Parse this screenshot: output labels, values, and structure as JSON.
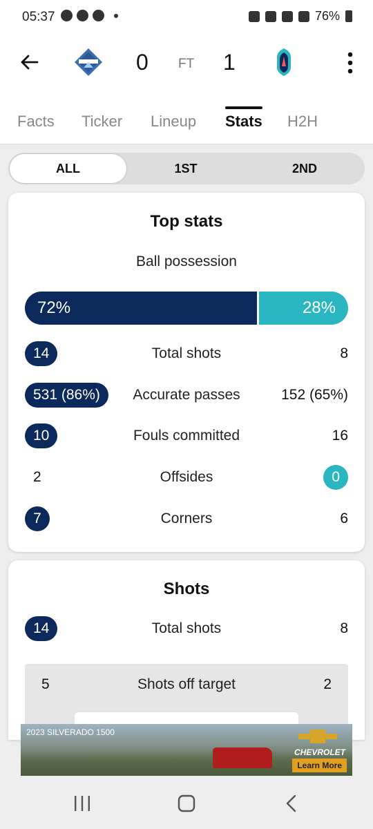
{
  "status_bar": {
    "time": "05:37",
    "battery": "76%"
  },
  "match": {
    "home_score": "0",
    "status": "FT",
    "away_score": "1"
  },
  "tabs": [
    {
      "label": "Facts"
    },
    {
      "label": "Ticker"
    },
    {
      "label": "Lineup"
    },
    {
      "label": "Stats"
    },
    {
      "label": "H2H"
    }
  ],
  "periods": [
    {
      "label": "ALL"
    },
    {
      "label": "1ST"
    },
    {
      "label": "2ND"
    }
  ],
  "top_stats": {
    "title": "Top stats",
    "possession": {
      "label": "Ball possession",
      "home": "72%",
      "away": "28%",
      "home_fraction": 0.72
    },
    "rows": [
      {
        "label": "Total shots",
        "home": "14",
        "away": "8"
      },
      {
        "label": "Accurate passes",
        "home": "531 (86%)",
        "away": "152 (65%)"
      },
      {
        "label": "Fouls committed",
        "home": "10",
        "away": "16"
      },
      {
        "label": "Offsides",
        "home": "2",
        "away": "0"
      },
      {
        "label": "Corners",
        "home": "7",
        "away": "6"
      }
    ]
  },
  "shots": {
    "title": "Shots",
    "rows": [
      {
        "label": "Total shots",
        "home": "14",
        "away": "8"
      },
      {
        "label": "Shots off target",
        "home": "5",
        "away": "2"
      }
    ]
  },
  "ad": {
    "title": "2023 SILVERADO 1500",
    "brand": "CHEVROLET",
    "cta": "Learn More"
  },
  "colors": {
    "home": "#0b2a5b",
    "away": "#2ab6c0"
  }
}
